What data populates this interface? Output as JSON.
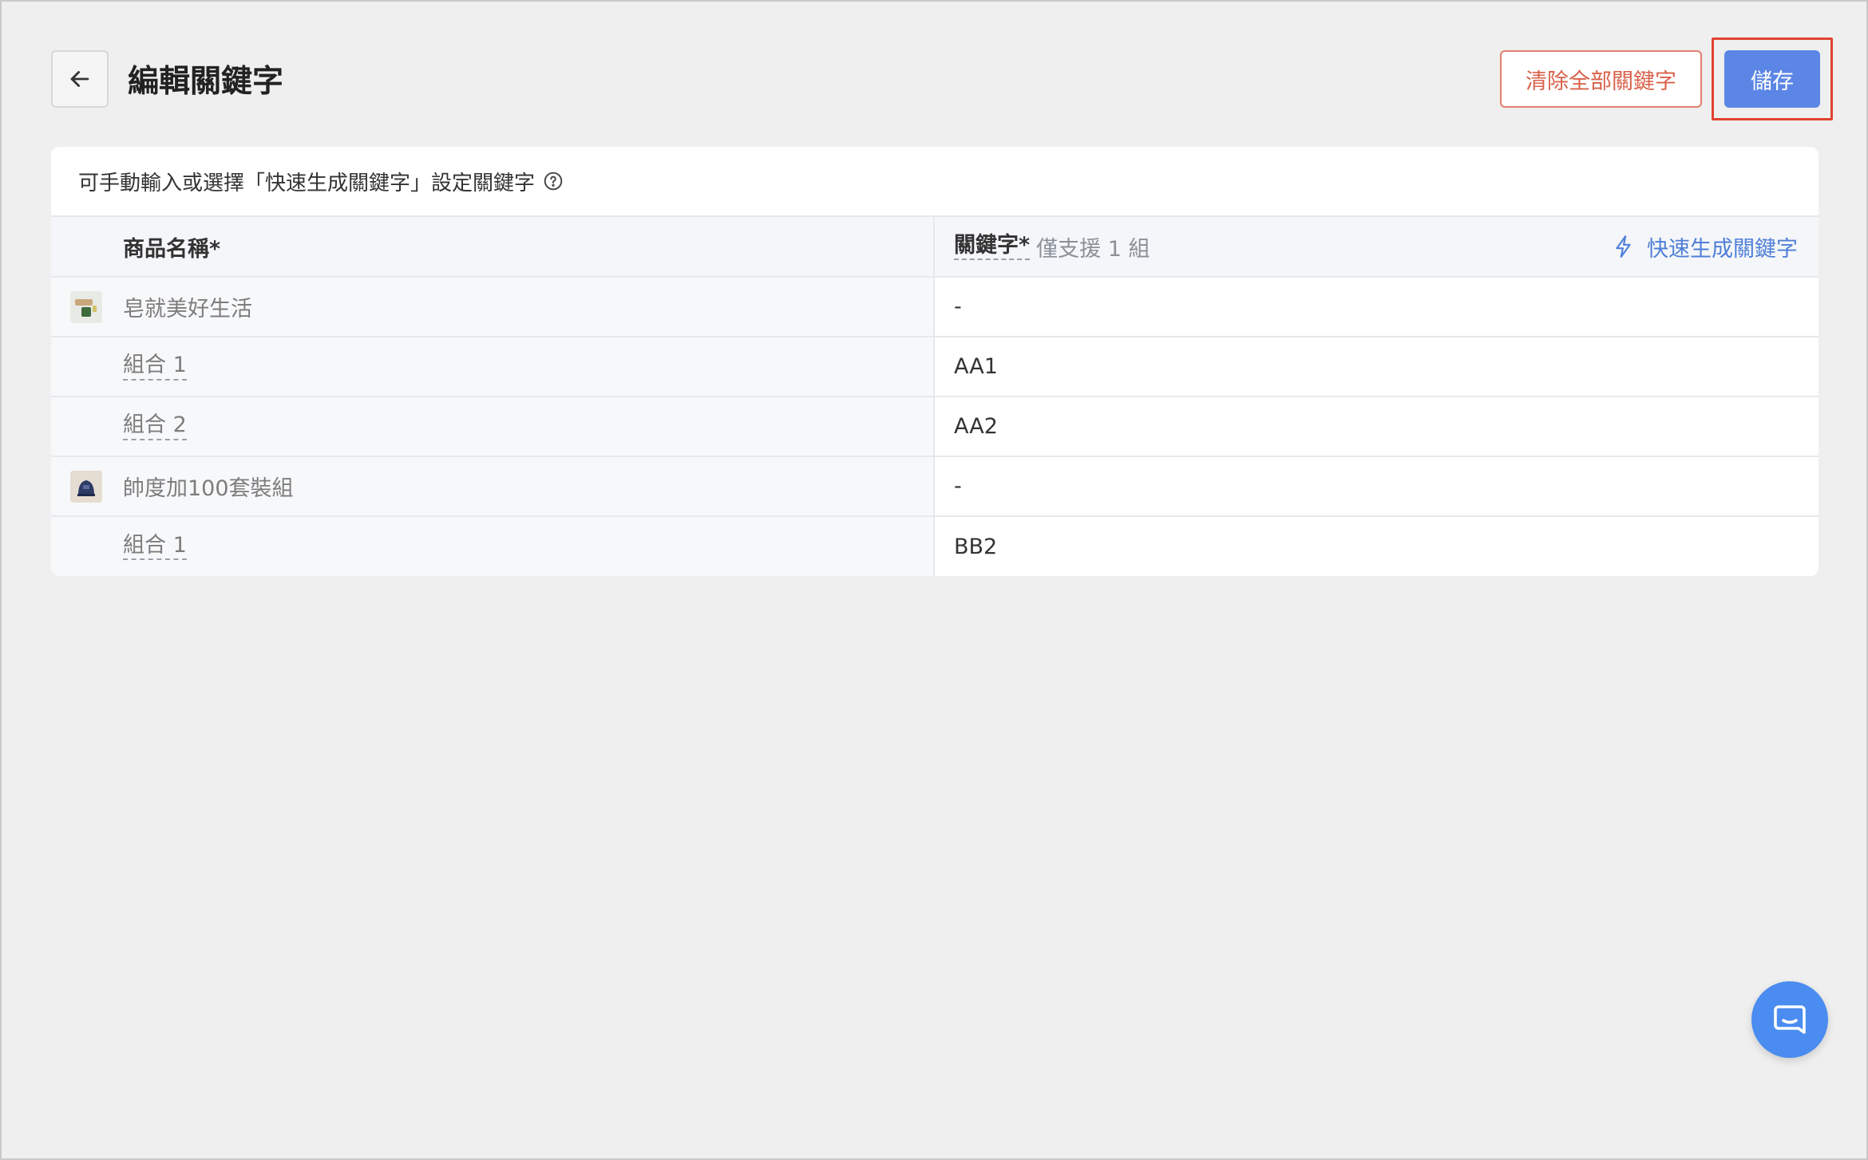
{
  "header": {
    "title": "編輯關鍵字",
    "clear_label": "清除全部關鍵字",
    "save_label": "儲存"
  },
  "card": {
    "hint": "可手動輸入或選擇「快速生成關鍵字」設定關鍵字"
  },
  "table": {
    "col_name": "商品名稱*",
    "col_keyword": "關鍵字*",
    "col_keyword_note": "僅支援 1 組",
    "quick_generate": "快速生成關鍵字",
    "rows": [
      {
        "type": "product",
        "name": "皂就美好生活",
        "keyword": "-",
        "icon": "soap-product-thumbnail"
      },
      {
        "type": "variant",
        "name": "組合 1",
        "keyword": "AA1"
      },
      {
        "type": "variant",
        "name": "組合 2",
        "keyword": "AA2"
      },
      {
        "type": "product",
        "name": "帥度加100套裝組",
        "keyword": "-",
        "icon": "bag-product-thumbnail"
      },
      {
        "type": "variant",
        "name": "組合 1",
        "keyword": "BB2"
      }
    ]
  },
  "colors": {
    "primary": "#5b86e5",
    "danger": "#d9614a",
    "link": "#4f7fd8",
    "chat": "#4a8cf0",
    "highlight_box": "#e0432f"
  }
}
